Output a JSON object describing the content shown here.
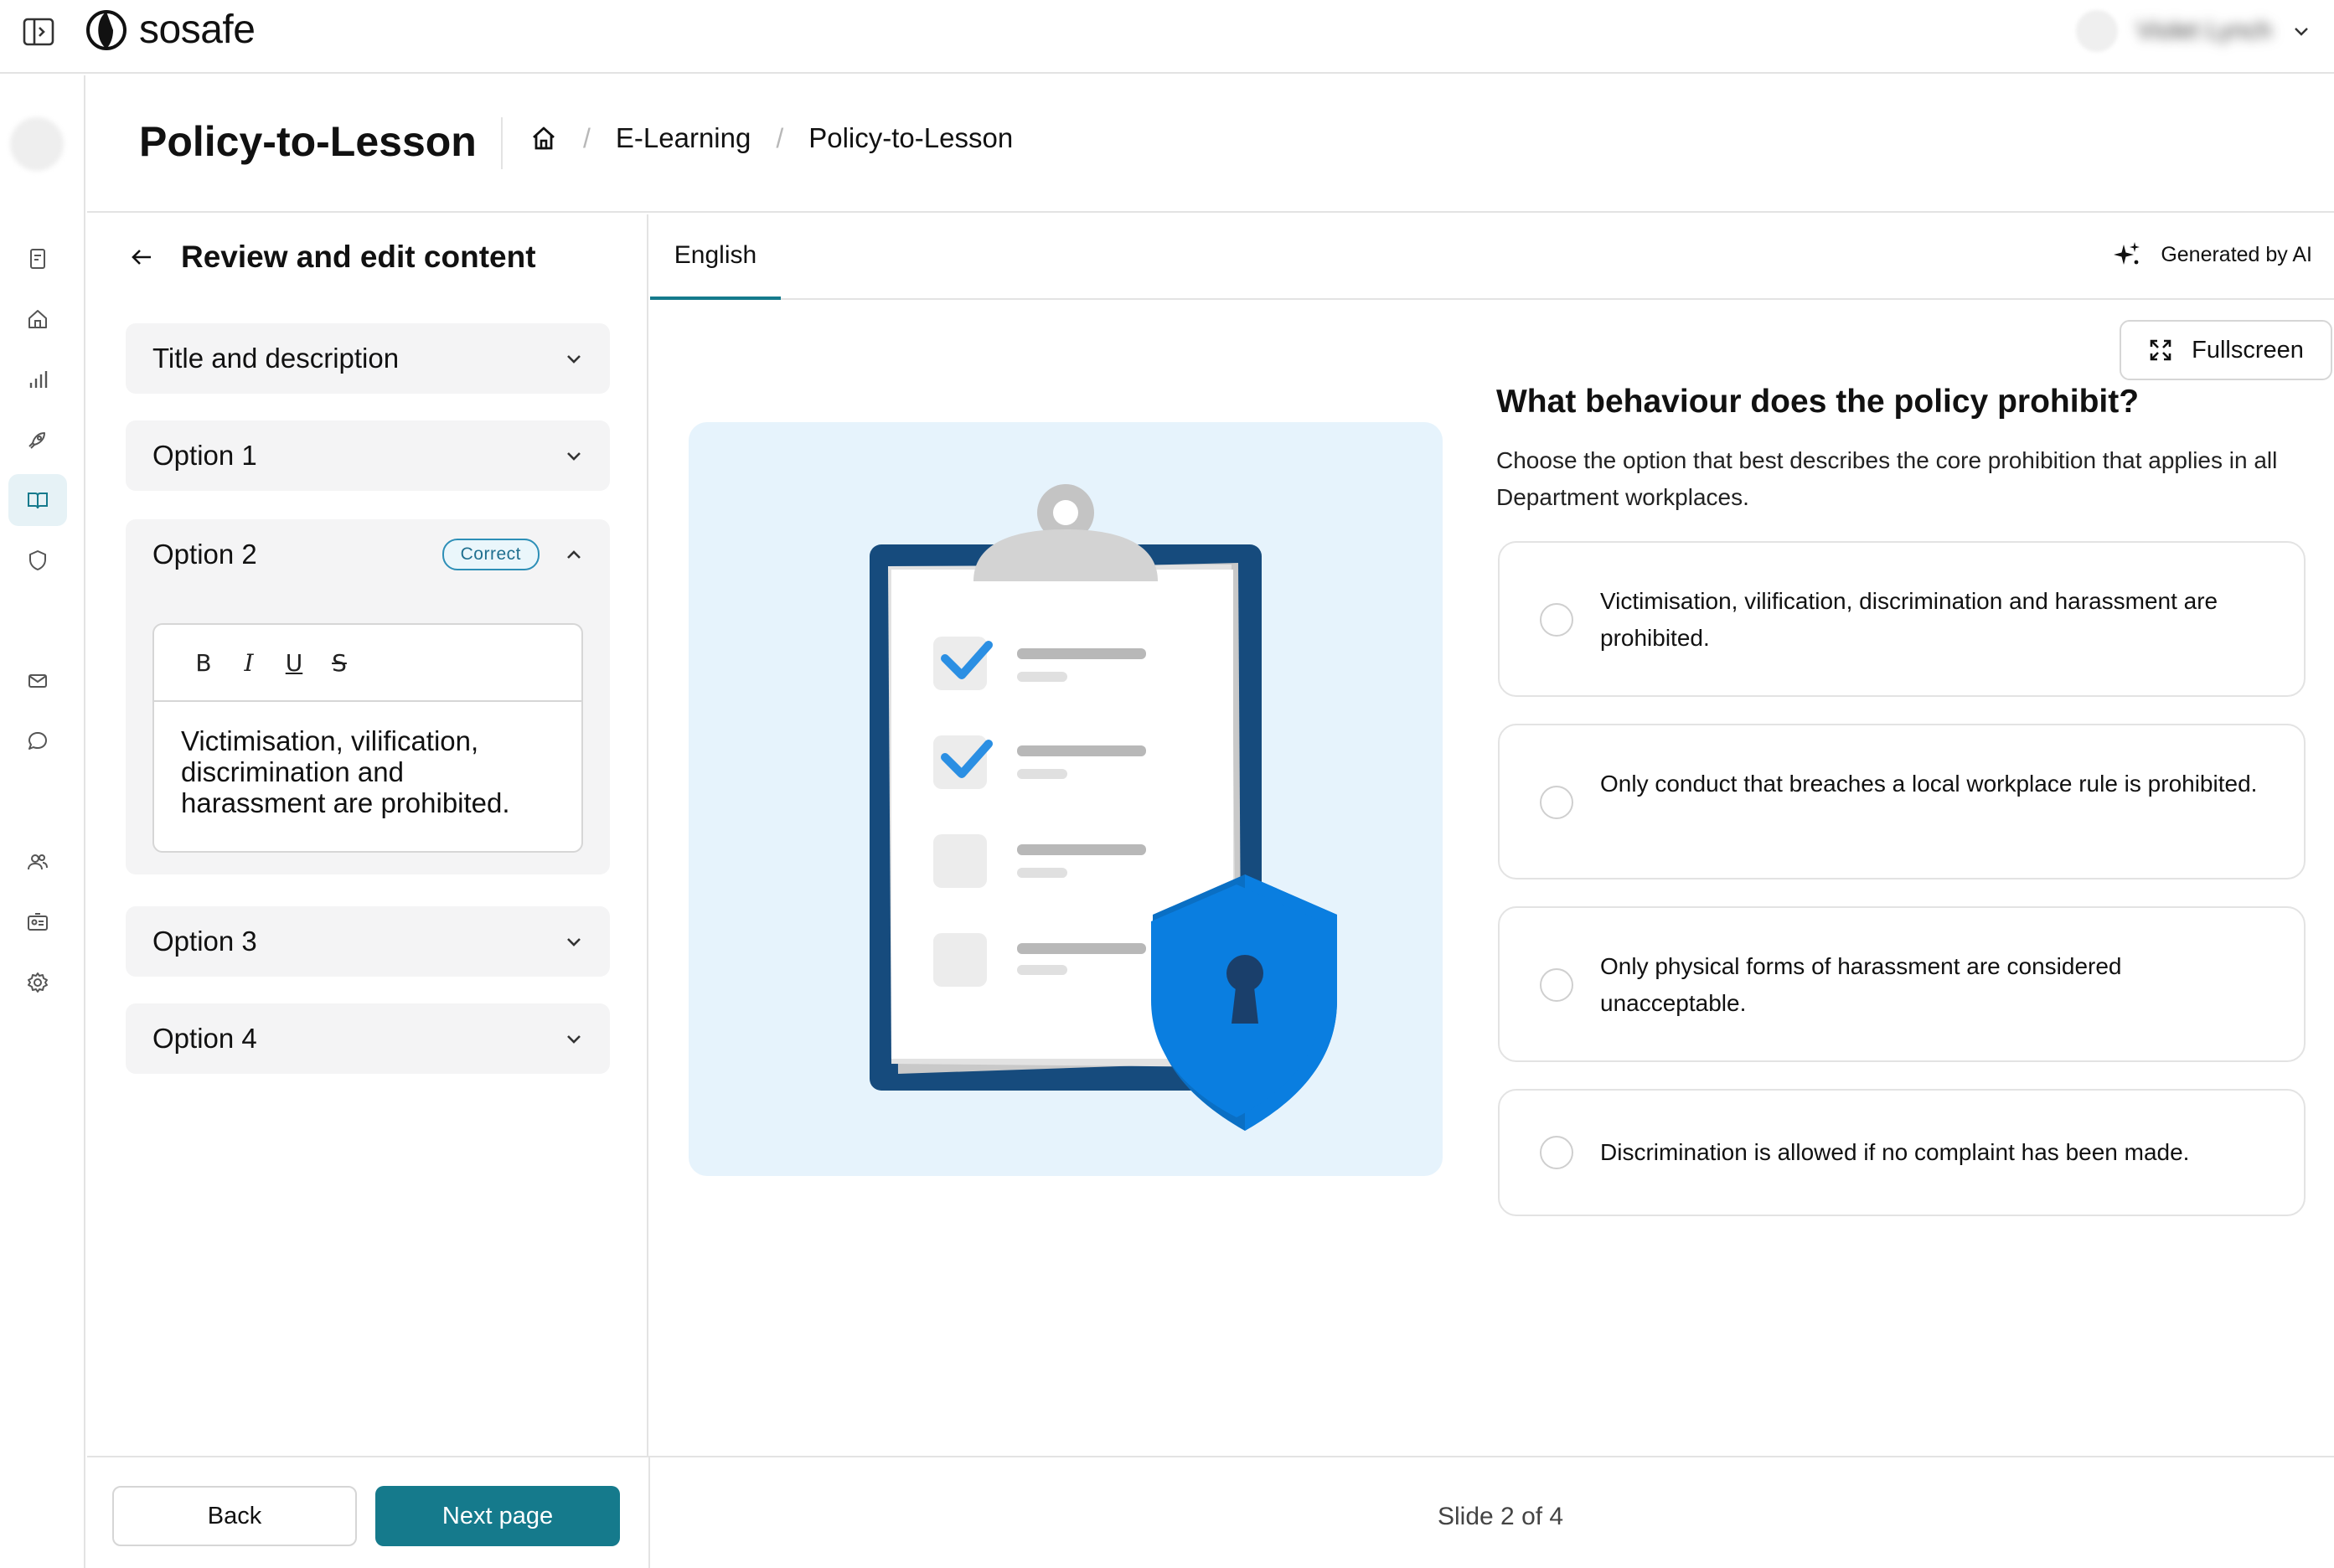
{
  "app": {
    "logo_text": "sosafe",
    "user_name": "Violet Lynch"
  },
  "header": {
    "title": "Policy-to-Lesson",
    "breadcrumb": [
      "E-Learning",
      "Policy-to-Lesson"
    ]
  },
  "sidebar": {
    "icons": [
      "report-icon",
      "home-icon",
      "analytics-icon",
      "rocket-icon",
      "book-icon",
      "shield-icon",
      "mail-icon",
      "chat-icon",
      "users-icon",
      "id-card-icon",
      "gear-icon"
    ],
    "active": "book-icon"
  },
  "editor": {
    "title": "Review and edit content",
    "sections": [
      {
        "label": "Title and description",
        "expanded": false
      },
      {
        "label": "Option 1",
        "expanded": false
      },
      {
        "label": "Option 2",
        "expanded": true,
        "badge": "Correct",
        "text": "Victimisation, vilification, discrimination and harassment are prohibited."
      },
      {
        "label": "Option 3",
        "expanded": false
      },
      {
        "label": "Option 4",
        "expanded": false
      }
    ],
    "toolbar": [
      "B",
      "I",
      "U",
      "S"
    ]
  },
  "preview": {
    "tab": "English",
    "ai_label": "Generated by AI",
    "fullscreen_label": "Fullscreen",
    "question": "What behaviour does the policy prohibit?",
    "description": "Choose the option that best describes the core prohibition that applies in all Department workplaces.",
    "answers": [
      "Victimisation, vilification, discrimination and harassment are prohibited.",
      "Only conduct that breaches a local workplace rule is prohibited.",
      "Only physical forms of harassment are considered unacceptable.",
      "Discrimination is allowed if no complaint has been made."
    ]
  },
  "footer": {
    "back_label": "Back",
    "next_label": "Next page",
    "slide_status": "Slide 2 of 4"
  },
  "colors": {
    "accent": "#157a8c",
    "badge_border": "#2d8fb7",
    "illustration_bg": "#e6f3fc",
    "shield": "#0a7ee0",
    "clipboard": "#164b7d"
  }
}
